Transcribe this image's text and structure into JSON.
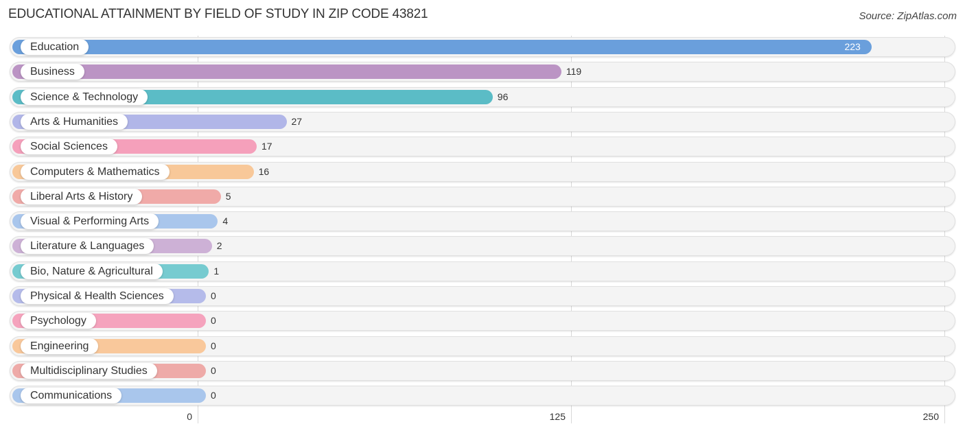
{
  "header": {
    "title": "EDUCATIONAL ATTAINMENT BY FIELD OF STUDY IN ZIP CODE 43821",
    "source": "Source: ZipAtlas.com"
  },
  "chart_data": {
    "type": "bar",
    "orientation": "horizontal",
    "title": "EDUCATIONAL ATTAINMENT BY FIELD OF STUDY IN ZIP CODE 43821",
    "xlabel": "",
    "ylabel": "",
    "xlim": [
      0,
      250
    ],
    "ticks": [
      "0",
      "125",
      "250"
    ],
    "tick_values": [
      0,
      125,
      250
    ],
    "grid": true,
    "categories": [
      "Education",
      "Business",
      "Science & Technology",
      "Arts & Humanities",
      "Social Sciences",
      "Computers & Mathematics",
      "Liberal Arts & History",
      "Visual & Performing Arts",
      "Literature & Languages",
      "Bio, Nature & Agricultural",
      "Physical & Health Sciences",
      "Psychology",
      "Engineering",
      "Multidisciplinary Studies",
      "Communications"
    ],
    "values": [
      223,
      119,
      96,
      27,
      17,
      16,
      5,
      4,
      2,
      1,
      0,
      0,
      0,
      0,
      0
    ],
    "value_labels": [
      "223",
      "119",
      "96",
      "27",
      "17",
      "16",
      "5",
      "4",
      "2",
      "1",
      "0",
      "0",
      "0",
      "0",
      "0"
    ],
    "colors": [
      "#6a9fdc",
      "#bb94c4",
      "#5bbcc6",
      "#b1b6e8",
      "#f5a0bb",
      "#f8c899",
      "#f0aaa8",
      "#a9c6ec",
      "#cdb1d6",
      "#76cbd0",
      "#b5bbea",
      "#f5a3bd",
      "#f9c89b",
      "#eeaaa8",
      "#a9c6ec"
    ]
  }
}
